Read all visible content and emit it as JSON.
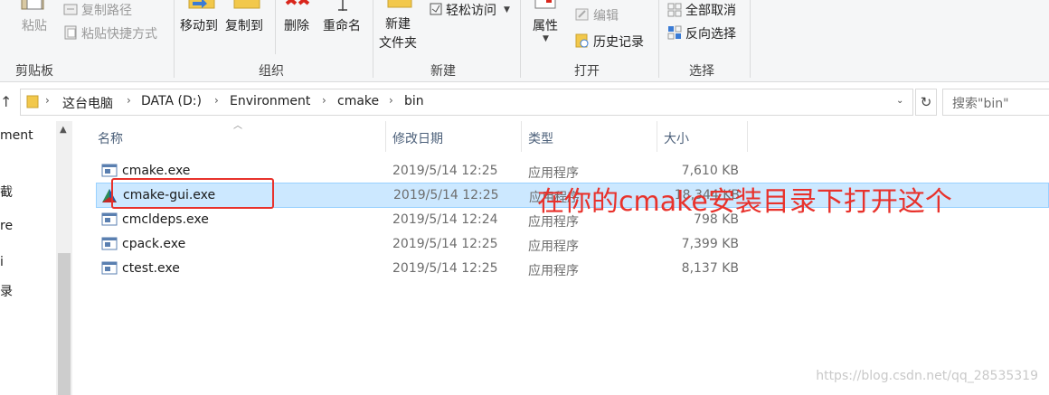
{
  "ribbon": {
    "clipboard": {
      "group_label": "剪贴板",
      "paste_label": "粘贴",
      "copy_path_label": "复制路径",
      "paste_shortcut_label": "粘贴快捷方式"
    },
    "organize": {
      "group_label": "组织",
      "move_to_label": "移动到",
      "copy_to_label": "复制到",
      "delete_label": "删除",
      "rename_label": "重命名"
    },
    "new": {
      "group_label": "新建",
      "new_folder_label": "新建\n文件夹",
      "easy_access_label": "轻松访问"
    },
    "open": {
      "group_label": "打开",
      "properties_label": "属性",
      "edit_label": "编辑",
      "history_label": "历史记录"
    },
    "select": {
      "group_label": "选择",
      "select_none_label": "全部取消",
      "invert_label": "反向选择"
    }
  },
  "address": {
    "crumbs": [
      "这台电脑",
      "DATA (D:)",
      "Environment",
      "cmake",
      "bin"
    ]
  },
  "search": {
    "placeholder": "搜索\"bin\""
  },
  "nav": {
    "items": [
      "ment",
      "截",
      "re",
      "i",
      "录"
    ]
  },
  "columns": {
    "name": "名称",
    "date": "修改日期",
    "type": "类型",
    "size": "大小"
  },
  "files": [
    {
      "name": "cmake.exe",
      "date": "2019/5/14 12:25",
      "type": "应用程序",
      "size": "7,610 KB",
      "icon": "exe-icon"
    },
    {
      "name": "cmake-gui.exe",
      "date": "2019/5/14 12:25",
      "type": "应用程序",
      "size": "18,344 KB",
      "icon": "cmake-gui-icon"
    },
    {
      "name": "cmcldeps.exe",
      "date": "2019/5/14 12:24",
      "type": "应用程序",
      "size": "798 KB",
      "icon": "exe-icon"
    },
    {
      "name": "cpack.exe",
      "date": "2019/5/14 12:25",
      "type": "应用程序",
      "size": "7,399 KB",
      "icon": "exe-icon"
    },
    {
      "name": "ctest.exe",
      "date": "2019/5/14 12:25",
      "type": "应用程序",
      "size": "8,137 KB",
      "icon": "exe-icon"
    }
  ],
  "selected_index": 1,
  "annotation": {
    "text": "在你的cmake安装目录下打开这个",
    "color": "#e8322c"
  },
  "watermark": "https://blog.csdn.net/qq_28535319",
  "colors": {
    "selection": "#cce8ff",
    "selection_border": "#99d1ff",
    "header_text": "#4c607a"
  }
}
